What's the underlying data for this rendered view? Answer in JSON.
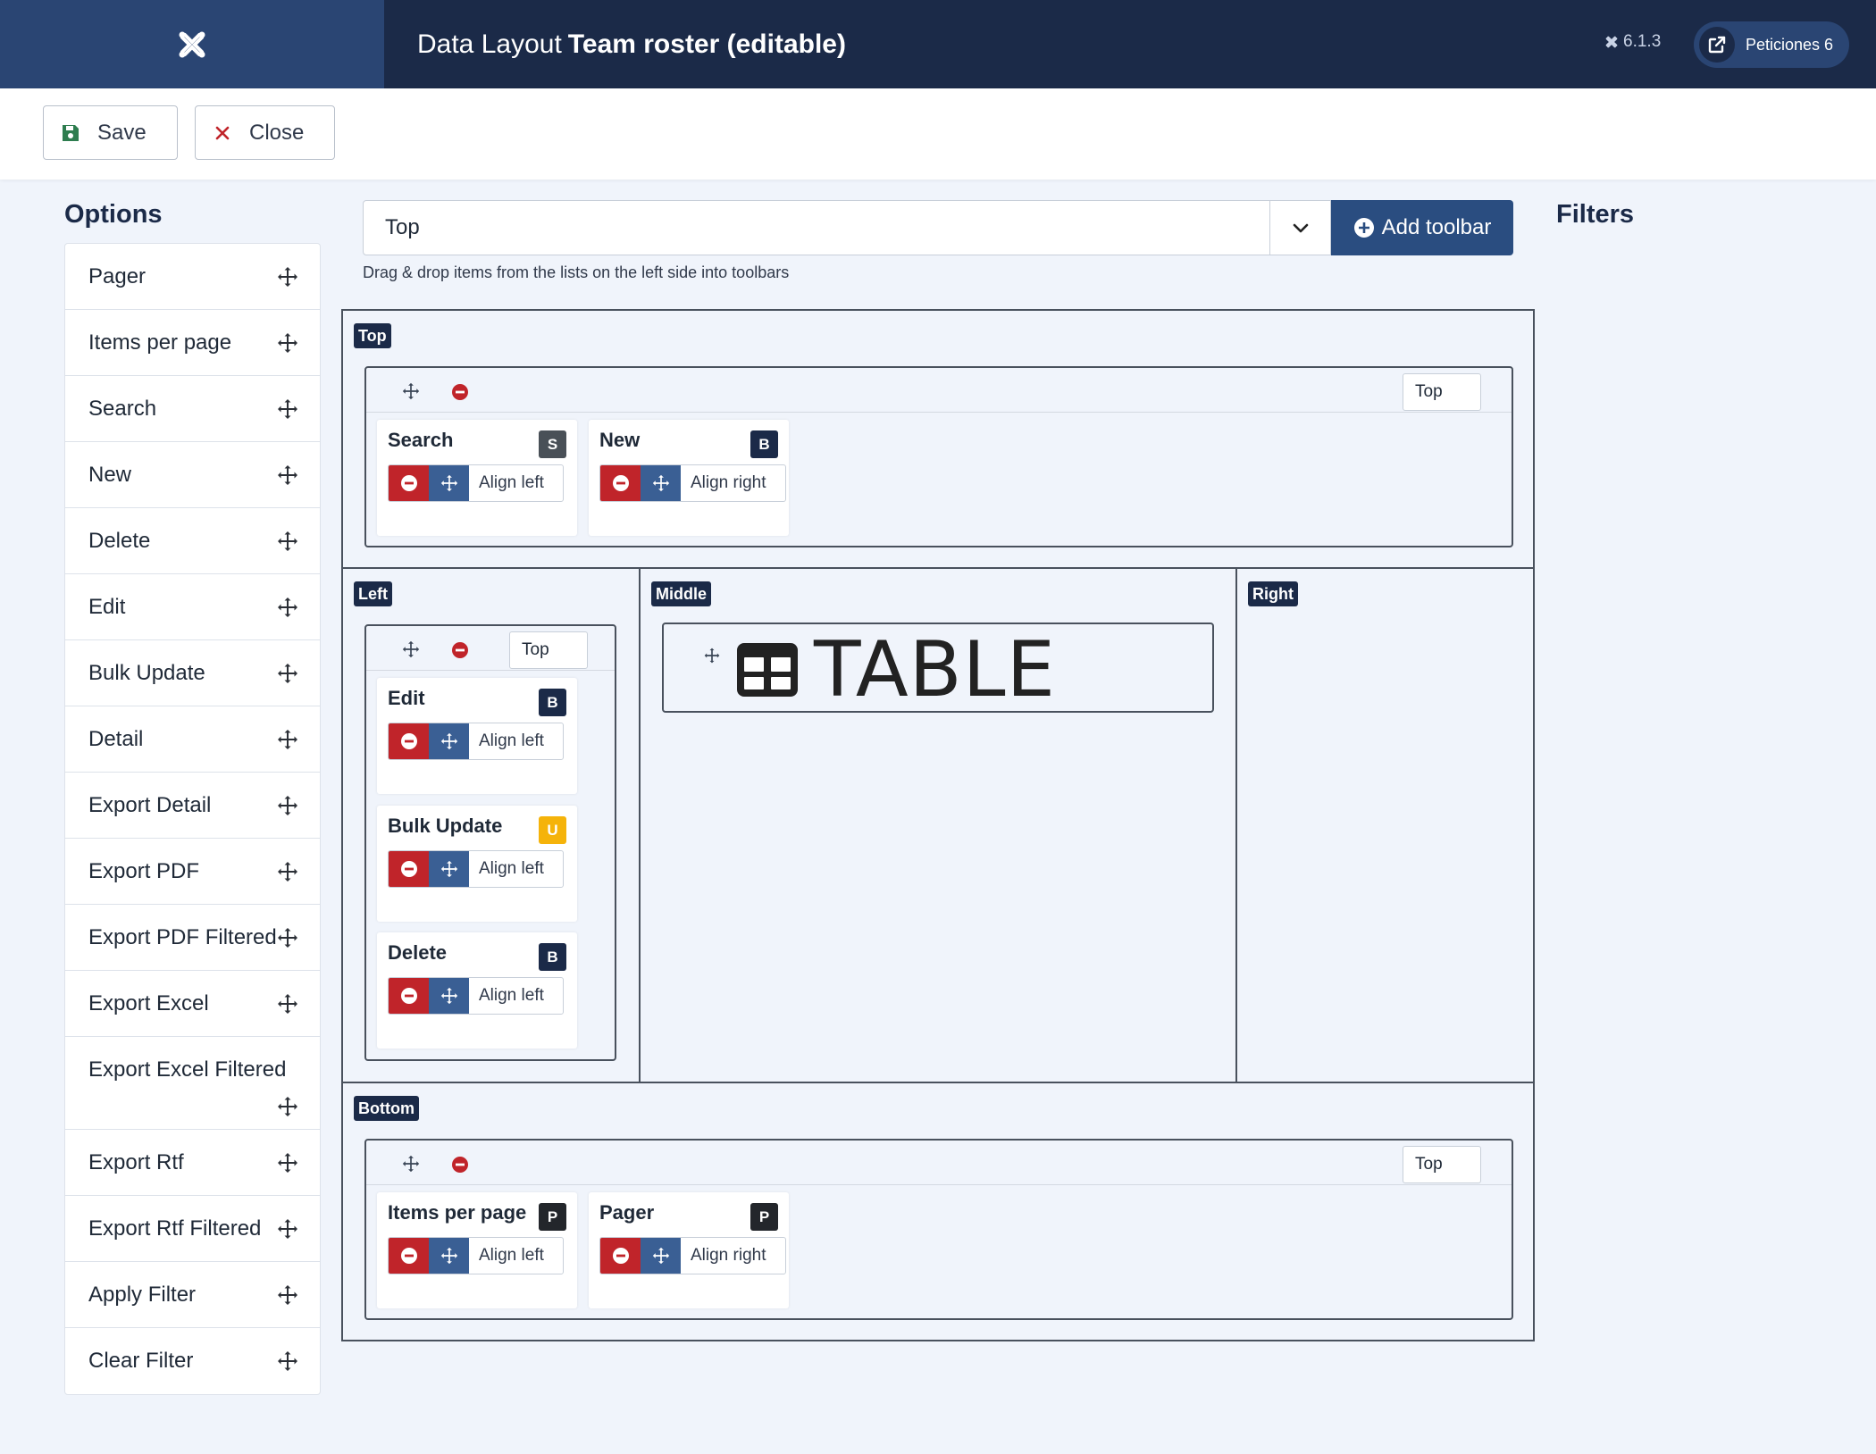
{
  "header": {
    "title_prefix": "Data Layout",
    "title_bold": "Team roster (editable)",
    "version": "6.1.3",
    "user_button": "Peticiones 6",
    "colors": {
      "header_bg": "#1b2a48",
      "accent": "#2a4d80"
    }
  },
  "toolbar": {
    "save_label": "Save",
    "close_label": "Close"
  },
  "options": {
    "title": "Options",
    "items": [
      "Pager",
      "Items per page",
      "Search",
      "New",
      "Delete",
      "Edit",
      "Bulk Update",
      "Detail",
      "Export Detail",
      "Export PDF",
      "Export PDF Filtered",
      "Export Excel",
      "Export Excel Filtered",
      "Export Rtf",
      "Export Rtf Filtered",
      "Apply Filter",
      "Clear Filter"
    ]
  },
  "toolbar_select": {
    "value": "Top",
    "add_label": "Add toolbar",
    "hint": "Drag & drop items from the lists on the left side into toolbars"
  },
  "filters": {
    "title": "Filters"
  },
  "layout": {
    "top": {
      "label": "Top",
      "position": "Top",
      "cards": [
        {
          "title": "Search",
          "badge": "S",
          "align": "Align left"
        },
        {
          "title": "New",
          "badge": "B",
          "align": "Align right"
        }
      ]
    },
    "left": {
      "label": "Left",
      "position": "Top",
      "cards": [
        {
          "title": "Edit",
          "badge": "B",
          "align": "Align left"
        },
        {
          "title": "Bulk Update",
          "badge": "U",
          "align": "Align left"
        },
        {
          "title": "Delete",
          "badge": "B",
          "align": "Align left"
        }
      ]
    },
    "middle": {
      "label": "Middle",
      "table_label": "TABLE"
    },
    "right": {
      "label": "Right"
    },
    "bottom": {
      "label": "Bottom",
      "position": "Top",
      "cards": [
        {
          "title": "Items per page",
          "badge": "P",
          "align": "Align left"
        },
        {
          "title": "Pager",
          "badge": "P",
          "align": "Align right"
        }
      ]
    }
  },
  "badge_colors": {
    "S": "#495057",
    "B": "#1b2a48",
    "U": "#f5b30a",
    "P": "#23262b"
  }
}
